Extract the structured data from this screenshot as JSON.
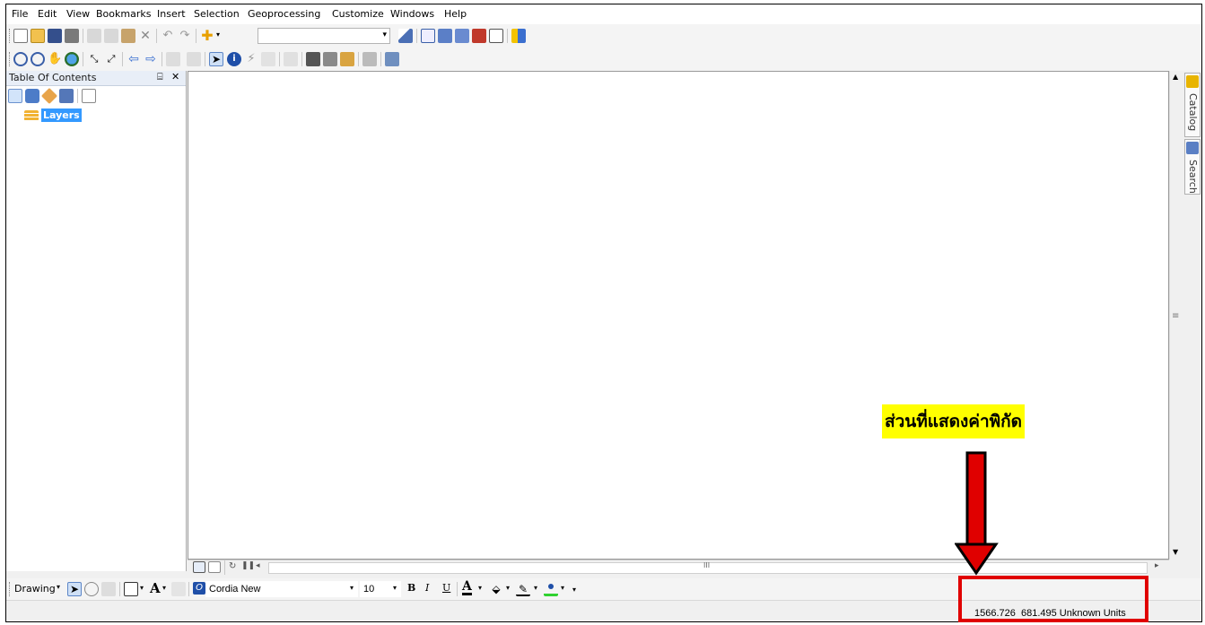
{
  "menu": [
    "File",
    "Edit",
    "View",
    "Bookmarks",
    "Insert",
    "Selection",
    "Geoprocessing",
    "Customize",
    "Windows",
    "Help"
  ],
  "standard_toolbar": {
    "icons": [
      "new-icon",
      "open-icon",
      "save-icon",
      "print-icon",
      "cut-icon",
      "copy-icon",
      "paste-icon",
      "delete-icon",
      "undo-icon",
      "redo-icon",
      "add-data-icon"
    ],
    "scale_value": "",
    "right_icons": [
      "editor-icon",
      "toc-window-icon",
      "catalog-window-icon",
      "search-window-icon",
      "arctoolbox-icon",
      "python-icon",
      "modelbuilder-icon"
    ]
  },
  "tools_toolbar": {
    "icons": [
      "zoom-in-icon",
      "zoom-out-icon",
      "pan-icon",
      "full-extent-icon",
      "fixed-zoom-in-icon",
      "fixed-zoom-out-icon",
      "back-icon",
      "forward-icon",
      "select-features-icon",
      "clear-selection-icon",
      "select-elements-icon",
      "identify-icon",
      "hyperlink-icon",
      "html-popup-icon",
      "measure-icon",
      "find-icon",
      "find-route-icon",
      "goto-xy-icon",
      "time-slider-icon",
      "viewer-icon"
    ]
  },
  "toc": {
    "title": "Table Of Contents",
    "pin": "⌸",
    "close": "✕",
    "toolbar_icons": [
      "list-by-drawing-order-icon",
      "list-by-source-icon",
      "list-by-visibility-icon",
      "list-by-selection-icon",
      "options-icon"
    ],
    "root_layer": "Layers"
  },
  "side_tabs": [
    "Catalog",
    "Search"
  ],
  "scrollbar": {
    "grip": "≡",
    "hgrip": "III"
  },
  "drawing_toolbar": {
    "label": "Drawing",
    "font_name": "Cordia New",
    "font_size": "10",
    "bold": "B",
    "italic": "I",
    "underline": "U",
    "text_tool": "A",
    "font_color": "A"
  },
  "status_bar": {
    "coordinates": "1566.726  681.495 Unknown Units"
  },
  "annotation": {
    "label": "ส่วนที่แสดงค่าพิกัด",
    "highlight_color": "#ffff00",
    "box_color": "#e00000"
  }
}
